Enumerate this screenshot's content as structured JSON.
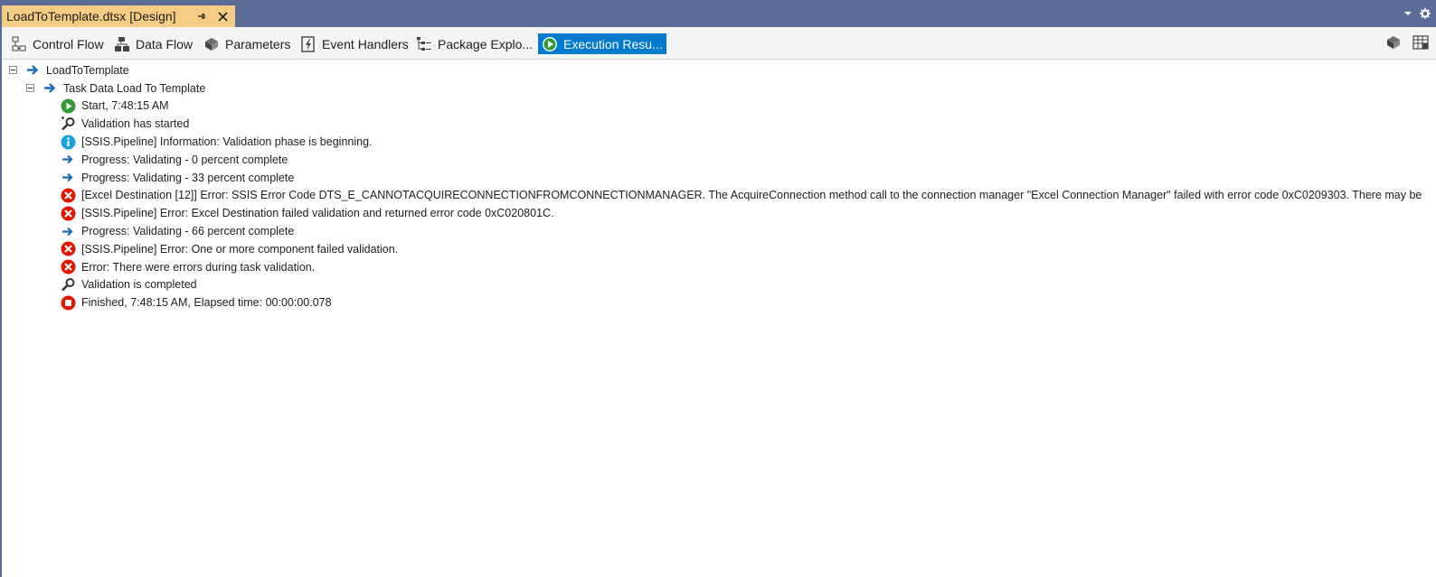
{
  "document_tab": {
    "title": "LoadToTemplate.dtsx [Design]",
    "pin_icon": "pin-icon",
    "close_icon": "close-icon"
  },
  "window_controls": {
    "dropdown_icon": "chevron-down-icon",
    "settings_icon": "gear-icon"
  },
  "designer_tabs": [
    {
      "label": "Control Flow",
      "icon": "control-flow-icon",
      "active": false
    },
    {
      "label": "Data Flow",
      "icon": "data-flow-icon",
      "active": false
    },
    {
      "label": "Parameters",
      "icon": "parameters-icon",
      "active": false
    },
    {
      "label": "Event Handlers",
      "icon": "event-handlers-icon",
      "active": false
    },
    {
      "label": "Package Explo...",
      "icon": "package-explorer-icon",
      "active": false
    },
    {
      "label": "Execution Resu...",
      "icon": "play-icon",
      "active": true
    }
  ],
  "toolbar_right_icons": [
    "cube-icon",
    "grid-icon"
  ],
  "tree": {
    "root": {
      "label": "LoadToTemplate",
      "icon": "arrow-right-icon"
    },
    "task": {
      "label": "Task Data Load To Template",
      "icon": "arrow-right-icon"
    },
    "messages": [
      {
        "icon": "start-icon",
        "text": "Start, 7:48:15 AM"
      },
      {
        "icon": "validation-icon",
        "text": "Validation has started"
      },
      {
        "icon": "info-icon",
        "text": "[SSIS.Pipeline] Information: Validation phase is beginning."
      },
      {
        "icon": "progress-icon",
        "text": "Progress: Validating - 0 percent complete"
      },
      {
        "icon": "progress-icon",
        "text": "Progress: Validating - 33 percent complete"
      },
      {
        "icon": "error-icon",
        "text": "[Excel Destination [12]] Error: SSIS Error Code DTS_E_CANNOTACQUIRECONNECTIONFROMCONNECTIONMANAGER.  The AcquireConnection method call to the connection manager \"Excel Connection Manager\" failed with error code 0xC0209303.  There may be"
      },
      {
        "icon": "error-icon",
        "text": "[SSIS.Pipeline] Error: Excel Destination failed validation and returned error code 0xC020801C."
      },
      {
        "icon": "progress-icon",
        "text": "Progress: Validating - 66 percent complete"
      },
      {
        "icon": "error-icon",
        "text": "[SSIS.Pipeline] Error: One or more component failed validation."
      },
      {
        "icon": "error-icon",
        "text": "Error: There were errors during task validation."
      },
      {
        "icon": "validation-complete-icon",
        "text": "Validation is completed"
      },
      {
        "icon": "stop-icon",
        "text": "Finished, 7:48:15 AM, Elapsed time: 00:00:00.078"
      }
    ]
  },
  "colors": {
    "chrome": "#5d6b99",
    "tab_active": "#f5cc84",
    "accent": "#007acc",
    "error": "#e51400",
    "success": "#339933",
    "info": "#1ba1e2",
    "progress": "#1e6bb8"
  }
}
